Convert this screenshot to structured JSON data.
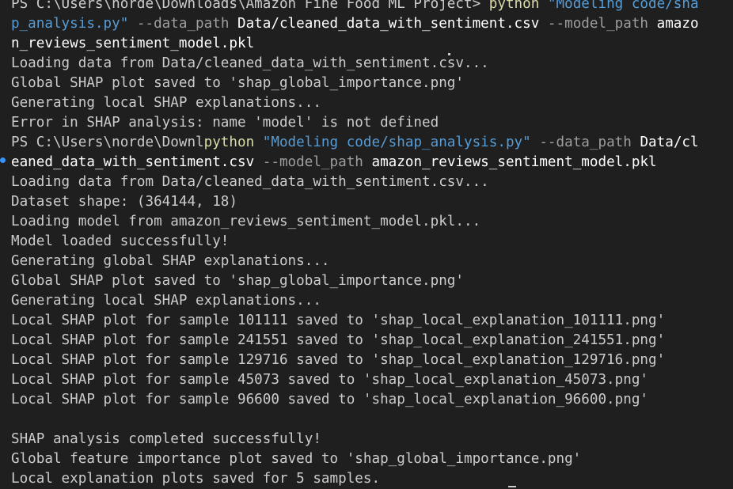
{
  "terminal": {
    "lines": [
      [
        {
          "t": "PS C:\\Users\\norde\\Downloads\\Amazon Fine Food ML Project> ",
          "c": "plain"
        },
        {
          "t": "python",
          "c": "cmd"
        },
        {
          "t": " \"Modeling code/sha",
          "c": "str"
        }
      ],
      [
        {
          "t": "p_analysis.py\"",
          "c": "str"
        },
        {
          "t": " --data_path ",
          "c": "param"
        },
        {
          "t": "Data/cleaned_data_with_sentiment.csv",
          "c": "arg"
        },
        {
          "t": " --model_path ",
          "c": "param"
        },
        {
          "t": "amazo",
          "c": "arg"
        }
      ],
      [
        {
          "t": "n_reviews_sentiment_model.pkl",
          "c": "arg"
        }
      ],
      [
        {
          "t": "Loading data from Data/cleaned_data_with_sentiment.csv...",
          "c": "plain"
        }
      ],
      [
        {
          "t": "Global SHAP plot saved to 'shap_global_importance.png'",
          "c": "plain"
        }
      ],
      [
        {
          "t": "Generating local SHAP explanations...",
          "c": "plain"
        }
      ],
      [
        {
          "t": "Error in SHAP analysis: name 'model' is not defined",
          "c": "plain"
        }
      ],
      [
        {
          "t": "PS C:\\Users\\norde\\Downl",
          "c": "plain"
        },
        {
          "t": "python",
          "c": "cmd"
        },
        {
          "t": " \"Modeling code/shap_analysis.py\"",
          "c": "str"
        },
        {
          "t": " --data_path ",
          "c": "param"
        },
        {
          "t": "Data/cl",
          "c": "arg"
        }
      ],
      [
        {
          "t": "eaned_data_with_sentiment.csv",
          "c": "arg"
        },
        {
          "t": " --model_path ",
          "c": "param"
        },
        {
          "t": "amazon_reviews_sentiment_model.pkl",
          "c": "arg"
        }
      ],
      [
        {
          "t": "Loading data from Data/cleaned_data_with_sentiment.csv...",
          "c": "plain"
        }
      ],
      [
        {
          "t": "Dataset shape: (364144, 18)",
          "c": "plain"
        }
      ],
      [
        {
          "t": "Loading model from amazon_reviews_sentiment_model.pkl...",
          "c": "plain"
        }
      ],
      [
        {
          "t": "Model loaded successfully!",
          "c": "plain"
        }
      ],
      [
        {
          "t": "Generating global SHAP explanations...",
          "c": "plain"
        }
      ],
      [
        {
          "t": "Global SHAP plot saved to 'shap_global_importance.png'",
          "c": "plain"
        }
      ],
      [
        {
          "t": "Generating local SHAP explanations...",
          "c": "plain"
        }
      ],
      [
        {
          "t": "Local SHAP plot for sample 101111 saved to 'shap_local_explanation_101111.png'",
          "c": "plain"
        }
      ],
      [
        {
          "t": "Local SHAP plot for sample 241551 saved to 'shap_local_explanation_241551.png'",
          "c": "plain"
        }
      ],
      [
        {
          "t": "Local SHAP plot for sample 129716 saved to 'shap_local_explanation_129716.png'",
          "c": "plain"
        }
      ],
      [
        {
          "t": "Local SHAP plot for sample 45073 saved to 'shap_local_explanation_45073.png'",
          "c": "plain"
        }
      ],
      [
        {
          "t": "Local SHAP plot for sample 96600 saved to 'shap_local_explanation_96600.png'",
          "c": "plain"
        }
      ],
      [],
      [
        {
          "t": "SHAP analysis completed successfully!",
          "c": "plain"
        }
      ],
      [
        {
          "t": "Global feature importance plot saved to 'shap_global_importance.png'",
          "c": "plain"
        }
      ],
      [
        {
          "t": "Local explanation plots saved for 5 samples.",
          "c": "plain"
        }
      ]
    ]
  }
}
